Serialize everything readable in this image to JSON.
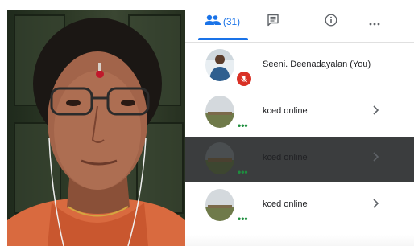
{
  "tabs": {
    "people_count": "(31)",
    "active": "people"
  },
  "participants": [
    {
      "name": "Seeni. Deenadayalan (You)",
      "muted": true,
      "selected": false,
      "has_chevron": false
    },
    {
      "name": "kced online",
      "muted": false,
      "selected": false,
      "has_chevron": true
    },
    {
      "name": "kced online",
      "muted": false,
      "selected": true,
      "has_chevron": true
    },
    {
      "name": "kced online",
      "muted": false,
      "selected": false,
      "has_chevron": true
    }
  ],
  "icons": {
    "people": "people-icon",
    "chat": "chat-icon",
    "info": "info-icon",
    "more": "more-horiz-icon",
    "mic_off": "mic-off-icon",
    "chevron": "chevron-right-icon"
  },
  "colors": {
    "accent": "#1a73e8",
    "mute_red": "#d93025",
    "speaking_green": "#1e8e3e",
    "selected_row": "#3b3d3e"
  }
}
